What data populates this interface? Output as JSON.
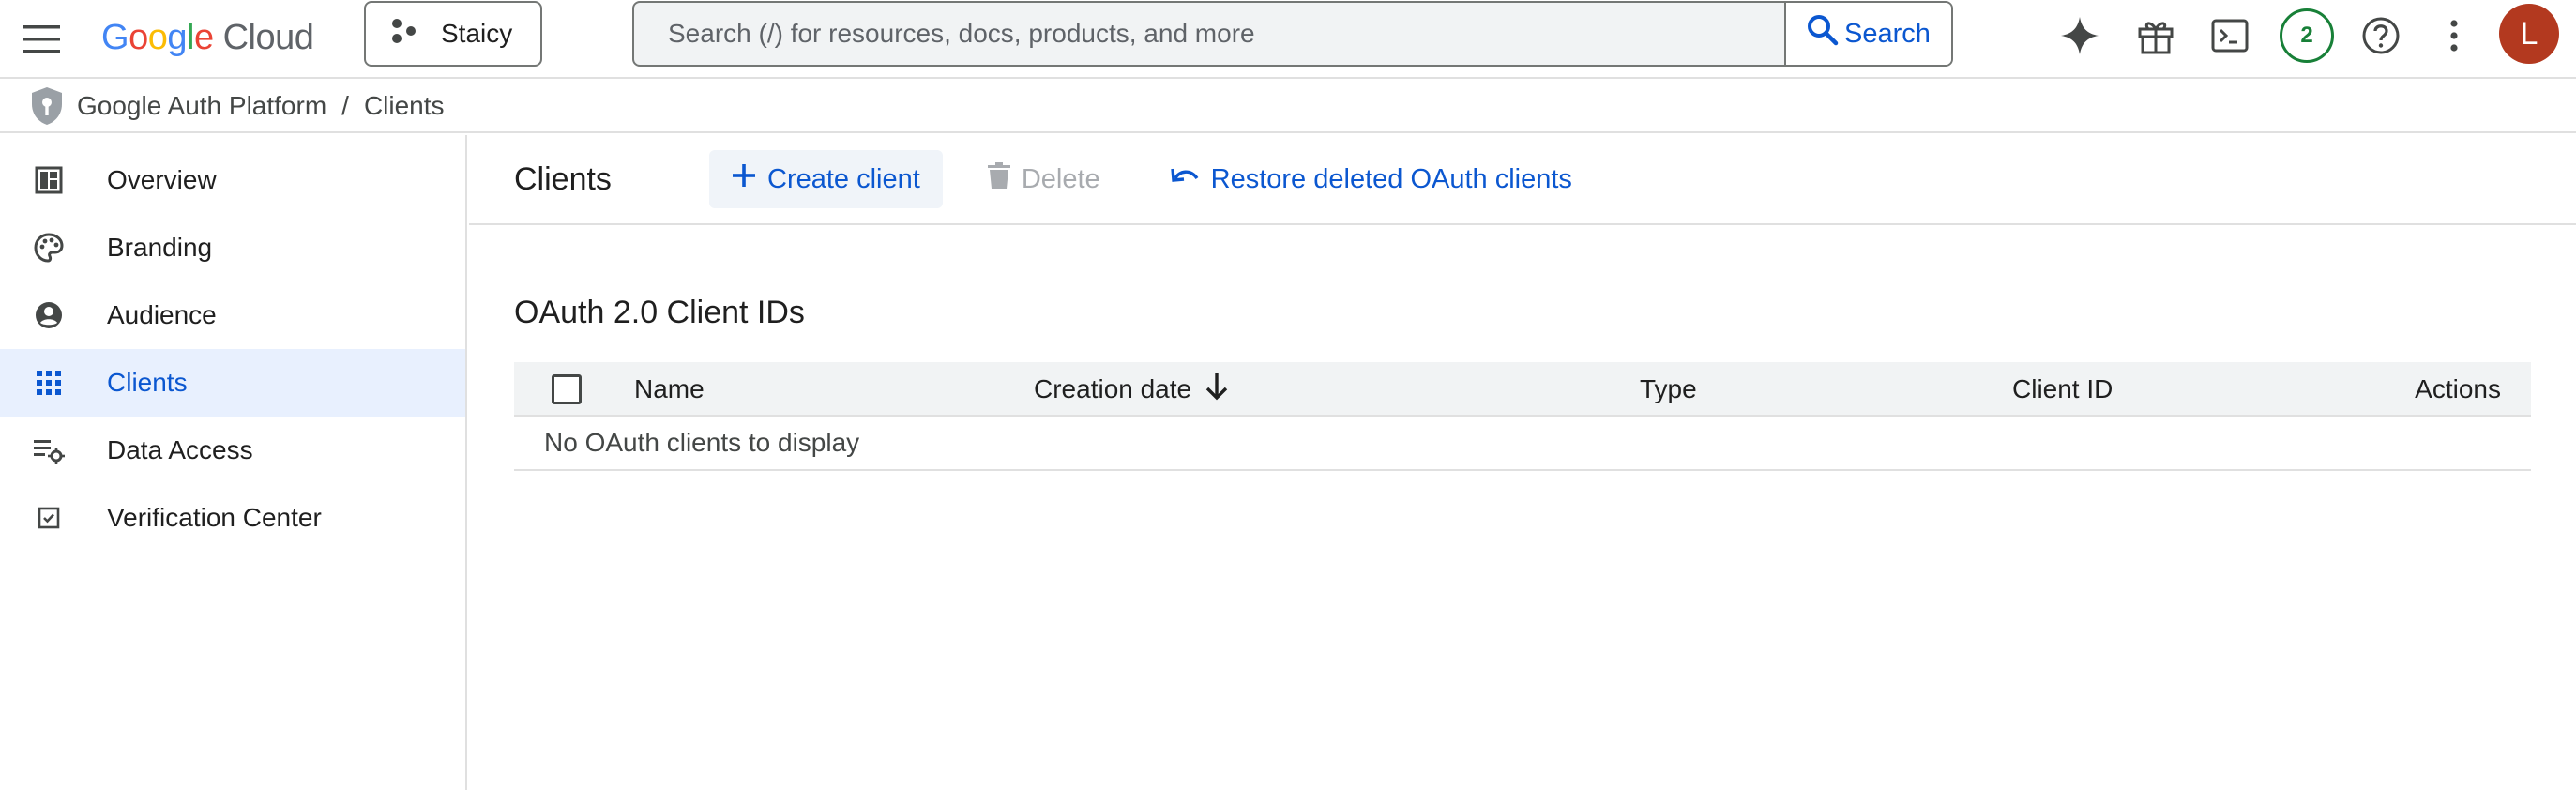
{
  "header": {
    "logo_google": [
      "G",
      "o",
      "o",
      "g",
      "l",
      "e"
    ],
    "logo_cloud": "Cloud",
    "project_name": "Staicy",
    "search_placeholder": "Search (/) for resources, docs, products, and more",
    "search_button": "Search",
    "notification_count": "2",
    "avatar_initial": "L"
  },
  "breadcrumb": {
    "product": "Google Auth Platform",
    "separator": "/",
    "current": "Clients"
  },
  "sidebar": {
    "items": [
      {
        "label": "Overview",
        "icon": "dashboard-icon"
      },
      {
        "label": "Branding",
        "icon": "palette-icon"
      },
      {
        "label": "Audience",
        "icon": "person-circle-icon"
      },
      {
        "label": "Clients",
        "icon": "grid-icon",
        "active": true
      },
      {
        "label": "Data Access",
        "icon": "data-settings-icon"
      },
      {
        "label": "Verification Center",
        "icon": "checkbox-icon"
      }
    ]
  },
  "main": {
    "title": "Clients",
    "create_button": "Create client",
    "delete_button": "Delete",
    "restore_button": "Restore deleted OAuth clients",
    "section_title": "OAuth 2.0 Client IDs",
    "table": {
      "columns": [
        "Name",
        "Creation date",
        "Type",
        "Client ID",
        "Actions"
      ],
      "sort_column": "Creation date",
      "sort_direction": "descending",
      "empty_message": "No OAuth clients to display"
    }
  },
  "colors": {
    "accent": "#0b57d0",
    "active_bg": "#e8f0fe",
    "badge": "#188038",
    "avatar": "#b3391f"
  }
}
